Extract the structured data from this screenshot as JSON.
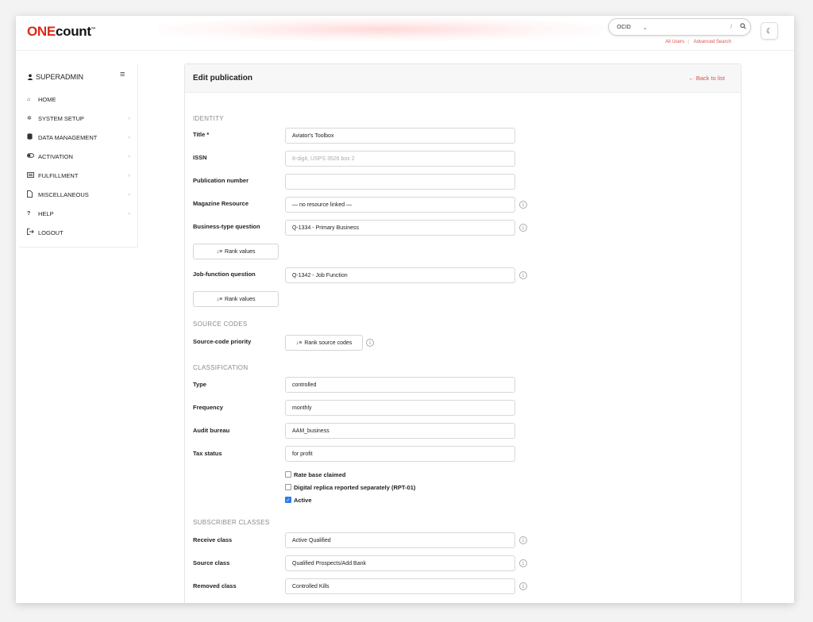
{
  "logo": {
    "part1": "ONE",
    "part2": "count",
    "tm": "™"
  },
  "search": {
    "type_value": "OCID",
    "placeholder": "",
    "shortcut": "/",
    "links": {
      "all_users": "All Users",
      "separator": "|",
      "advanced": "Advanced Search"
    }
  },
  "sidebar": {
    "user": "SUPERADMIN",
    "items": [
      {
        "label": "HOME",
        "icon": "home-icon",
        "has_arrow": false
      },
      {
        "label": "SYSTEM SETUP",
        "icon": "gear-icon",
        "has_arrow": true
      },
      {
        "label": "DATA MANAGEMENT",
        "icon": "database-icon",
        "has_arrow": true
      },
      {
        "label": "ACTIVATION",
        "icon": "toggle-icon",
        "has_arrow": true
      },
      {
        "label": "FULFILLMENT",
        "icon": "list-icon",
        "has_arrow": true
      },
      {
        "label": "MISCELLANEOUS",
        "icon": "file-icon",
        "has_arrow": true
      },
      {
        "label": "HELP",
        "icon": "question-icon",
        "has_arrow": true
      },
      {
        "label": "LOGOUT",
        "icon": "logout-icon",
        "has_arrow": false
      }
    ]
  },
  "page": {
    "title": "Edit publication",
    "back_link": "← Back to list"
  },
  "identity": {
    "section": "IDENTITY",
    "title_label": "Title *",
    "title_value": "Aviator's Toolbox",
    "issn_label": "ISSN",
    "issn_placeholder": "8-digit, USPS 3526 box 2",
    "pubnum_label": "Publication number",
    "pubnum_value": "",
    "resource_label": "Magazine Resource",
    "resource_value": "— no resource linked —",
    "business_label": "Business-type question",
    "business_value": "Q-1334 - Primary Business",
    "rank_values_1": "Rank values",
    "job_label": "Job-function question",
    "job_value": "Q-1342 - Job Function",
    "rank_values_2": "Rank values"
  },
  "source_codes": {
    "section": "SOURCE CODES",
    "priority_label": "Source-code priority",
    "rank_button": "Rank source codes"
  },
  "classification": {
    "section": "CLASSIFICATION",
    "type_label": "Type",
    "type_value": "controlled",
    "frequency_label": "Frequency",
    "frequency_value": "monthly",
    "audit_label": "Audit bureau",
    "audit_value": "AAM_business",
    "tax_label": "Tax status",
    "tax_value": "for profit",
    "checkboxes": [
      {
        "label": "Rate base claimed",
        "checked": false
      },
      {
        "label": "Digital replica reported separately (RPT-01)",
        "checked": false
      },
      {
        "label": "Active",
        "checked": true
      }
    ]
  },
  "subscriber_classes": {
    "section": "SUBSCRIBER CLASSES",
    "receive_label": "Receive class",
    "receive_value": "Active Qualified",
    "source_label": "Source class",
    "source_value": "Qualified Prospects/Add Bank",
    "removed_label": "Removed class",
    "removed_value": "Controlled Kills"
  },
  "colors": {
    "brand_red": "#e0281b",
    "link_red": "#d9534f",
    "checkbox_blue": "#2b7de9"
  }
}
